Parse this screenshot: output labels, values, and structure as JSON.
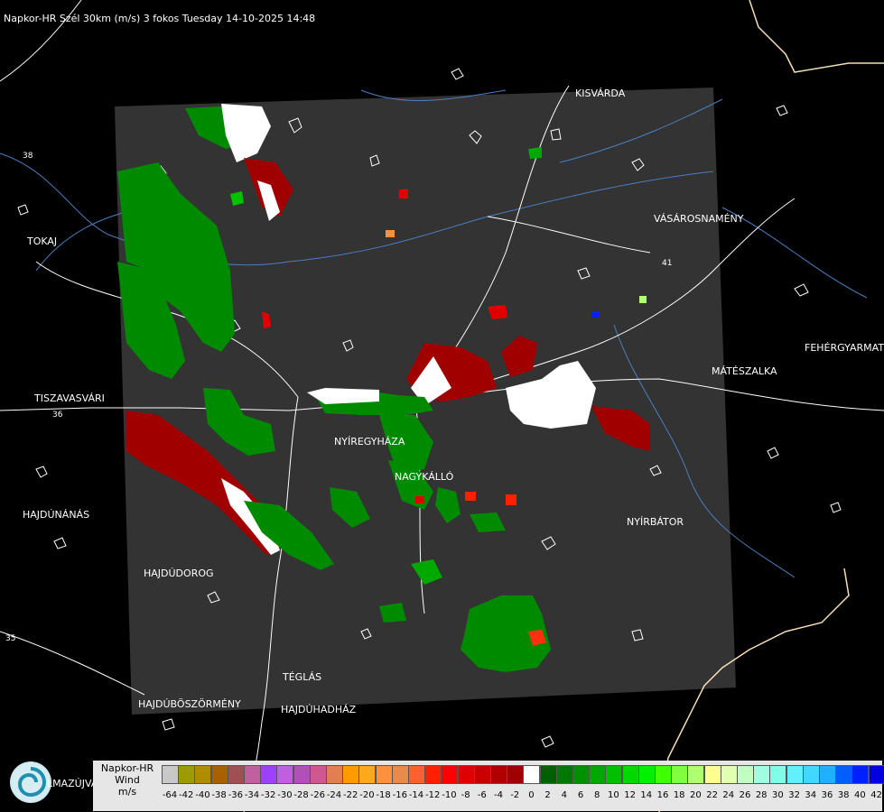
{
  "title": "Napkor-HR Szél 30km (m/s) 3 fokos Tuesday 14-10-2025 14:48",
  "cities": [
    {
      "name": "KISVÁRDA"
    },
    {
      "name": "VÁSÁROSNAMÉNY"
    },
    {
      "name": "TOKAJ"
    },
    {
      "name": "FEHÉRGYARMAT"
    },
    {
      "name": "MÁTÉSZALKA"
    },
    {
      "name": "TISZAVASVÁRI"
    },
    {
      "name": "NYÍREGYHÁZA"
    },
    {
      "name": "NAGYKÁLLÓ"
    },
    {
      "name": "HAJDÚNÁNÁS"
    },
    {
      "name": "NYÍRBÁTOR"
    },
    {
      "name": "HAJDÚDOROG"
    },
    {
      "name": "TÉGLÁS"
    },
    {
      "name": "HAJDÚBÖSZÖRMÉNY"
    },
    {
      "name": "HAJDÚHADHÁZ"
    }
  ],
  "road_numbers": [
    "38",
    "41",
    "36",
    "35"
  ],
  "legend": {
    "name_lines": [
      "Napkor-HR",
      "Wind",
      "m/s"
    ],
    "values": [
      -64,
      -42,
      -40,
      -38,
      -36,
      -34,
      -32,
      -30,
      -28,
      -26,
      -24,
      -22,
      -20,
      -18,
      -16,
      -14,
      -12,
      -10,
      -8,
      -6,
      -4,
      -2,
      0,
      2,
      4,
      6,
      8,
      10,
      12,
      14,
      16,
      18,
      20,
      22,
      24,
      26,
      28,
      30,
      32,
      34,
      36,
      38,
      40,
      42
    ],
    "colors": [
      "#c8c8c8",
      "#9c9c00",
      "#b08c00",
      "#a86000",
      "#a05050",
      "#c060a0",
      "#a040ff",
      "#c060e0",
      "#b050b8",
      "#d05890",
      "#e08050",
      "#ff9a00",
      "#ffa81c",
      "#ff9040",
      "#e88a4a",
      "#ff6030",
      "#ff2000",
      "#ff0000",
      "#e00000",
      "#c80000",
      "#b00000",
      "#a00000",
      "#ffffff",
      "#006000",
      "#007800",
      "#009000",
      "#00a800",
      "#00c000",
      "#00d800",
      "#00f000",
      "#40ff00",
      "#80ff40",
      "#b0ff70",
      "#ffff90",
      "#e0ffb0",
      "#c0ffc0",
      "#a0ffe0",
      "#80ffe8",
      "#60f0ff",
      "#40d8ff",
      "#20b0ff",
      "#0060ff",
      "#0020ff",
      "#0000e0"
    ]
  },
  "footer_text": "LMAZÚJVÁR",
  "colors": {
    "background": "#000000",
    "radar_area": "#333333",
    "boundary": "#ffffff",
    "county_border": "#f5deb3",
    "river": "#4a7fc0",
    "road": "#ffffff"
  }
}
